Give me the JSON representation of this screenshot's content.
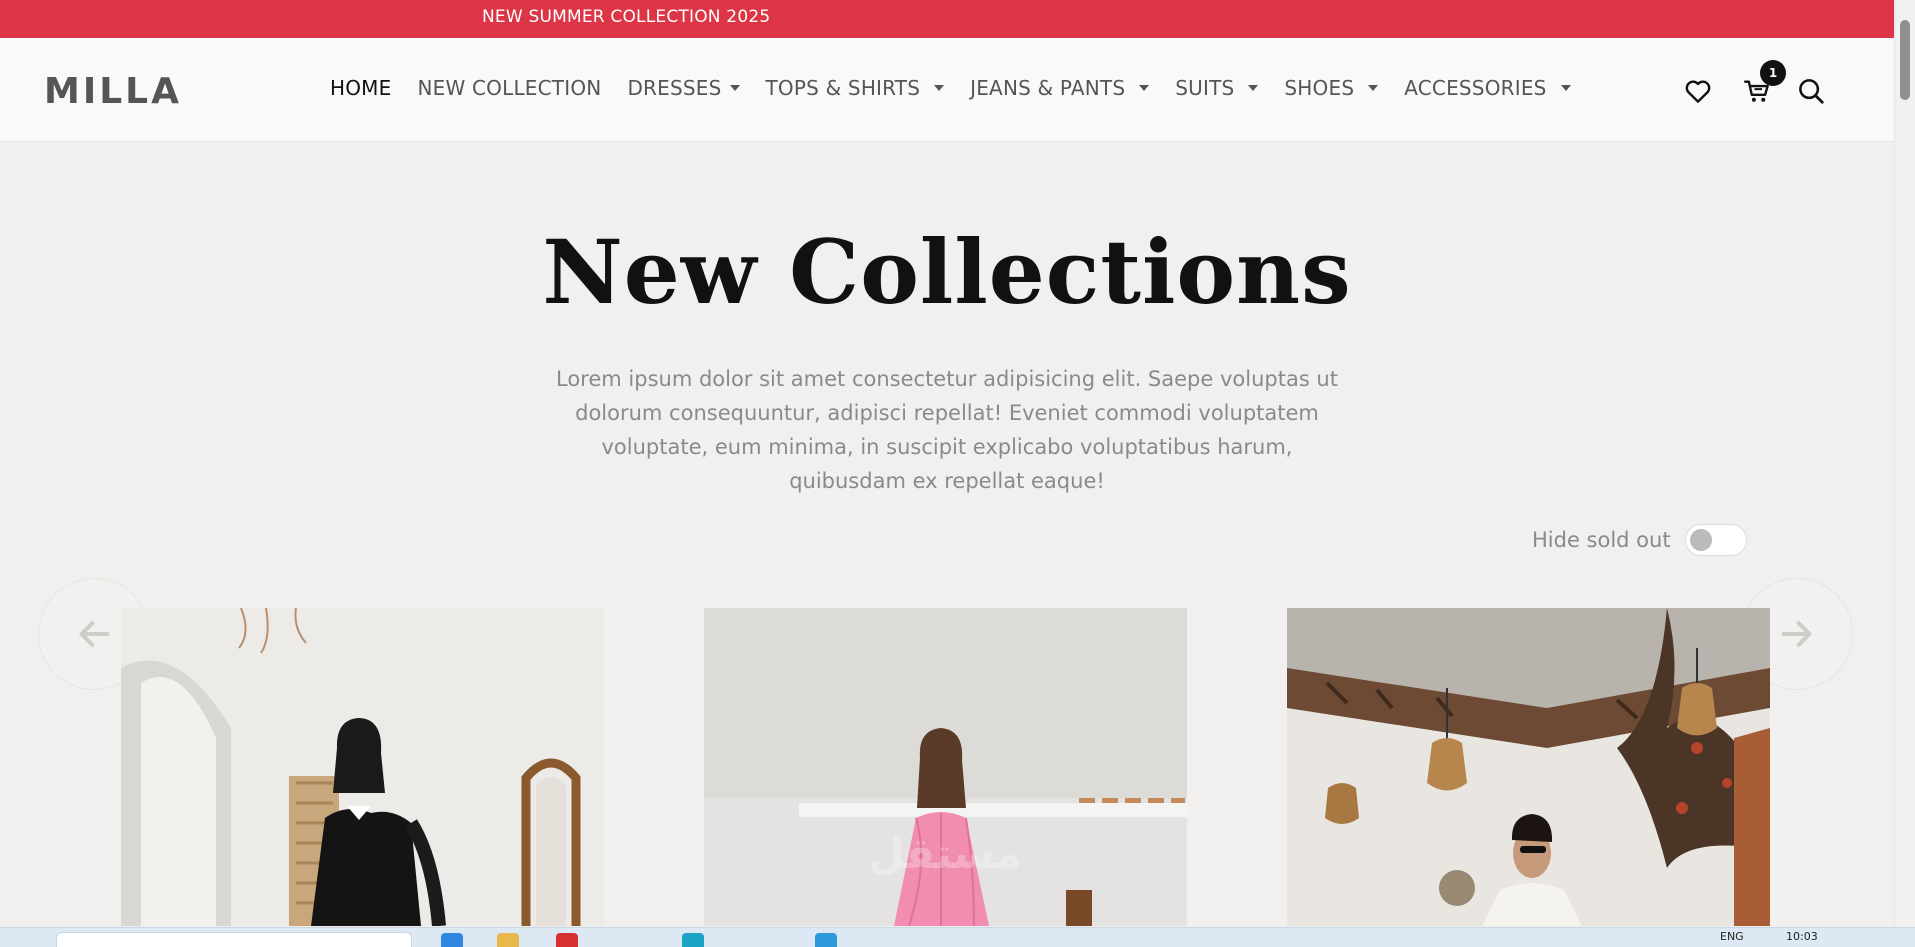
{
  "announcement": {
    "text": "NEW SUMMER COLLECTION 2025"
  },
  "header": {
    "logo": "MILLA",
    "nav": [
      {
        "label": "HOME",
        "active": true,
        "dropdown": false
      },
      {
        "label": "NEW COLLECTION",
        "active": false,
        "dropdown": false
      },
      {
        "label": "DRESSES",
        "active": false,
        "dropdown": true
      },
      {
        "label": "TOPS & SHIRTS",
        "active": false,
        "dropdown": true
      },
      {
        "label": "JEANS & PANTS",
        "active": false,
        "dropdown": true
      },
      {
        "label": "SUITS",
        "active": false,
        "dropdown": true
      },
      {
        "label": "SHOES",
        "active": false,
        "dropdown": true
      },
      {
        "label": "ACCESSORIES",
        "active": false,
        "dropdown": true
      }
    ],
    "icons": [
      "heart-icon",
      "cart-icon",
      "search-icon"
    ],
    "cart_count": "1"
  },
  "hero": {
    "title": "New Collections",
    "description": "Lorem ipsum dolor sit amet consectetur adipisicing elit. Saepe voluptas ut dolorum consequuntur, adipisci repellat! Eveniet commodi voluptatem voluptate, eum minima, in suscipit explicabo voluptatibus harum, quibusdam ex repellat eaque!"
  },
  "filter": {
    "hide_sold_out_label": "Hide sold out",
    "hide_sold_out_on": false
  },
  "carousel": {
    "prev_icon": "arrow-left-icon",
    "next_icon": "arrow-right-icon",
    "products": [
      {
        "image": "woman in black lace dress beside mirror"
      },
      {
        "image": "woman in pink dress in white room"
      },
      {
        "image": "woman in white knit dress on terrace"
      }
    ]
  },
  "taskbar": {
    "language": "ENG",
    "time": "10:03"
  },
  "colors": {
    "accent": "#dc3545",
    "header_bg": "#f8f9fa",
    "page_bg": "#f1f0ee",
    "text_muted": "#8a8a8a"
  }
}
